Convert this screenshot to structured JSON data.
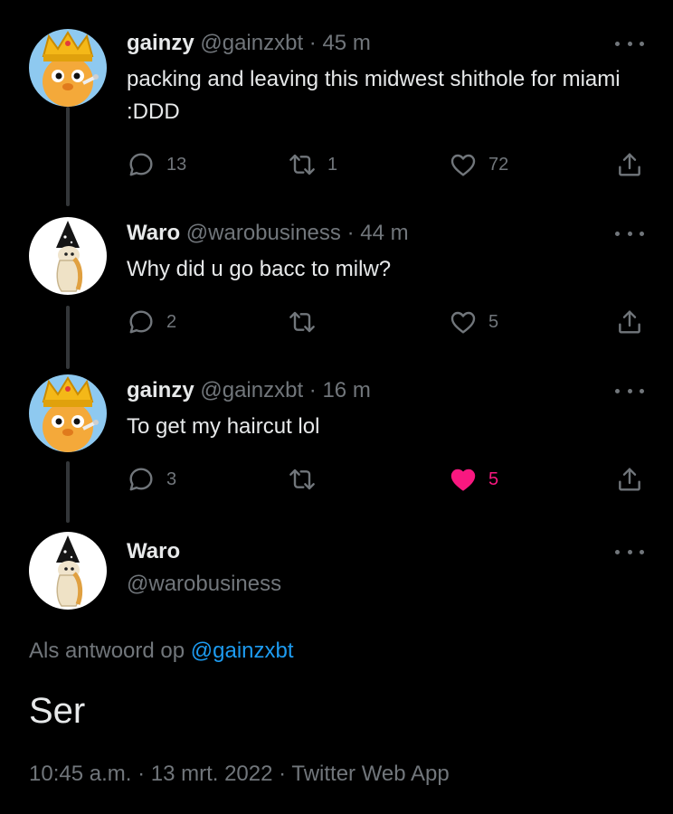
{
  "colors": {
    "background": "#000000",
    "text": "#e7e9ea",
    "muted": "#71767b",
    "accent": "#1d9bf0",
    "like": "#f91880"
  },
  "tweets": [
    {
      "name": "gainzy",
      "handle": "@gainzxbt",
      "time": "· 45 m",
      "text": "packing and leaving this midwest shithole for miami :DDD",
      "avatar": "gold-crown-bird-avatar",
      "replies": "13",
      "retweets": "1",
      "likes": "72",
      "liked": false
    },
    {
      "name": "Waro",
      "handle": "@warobusiness",
      "time": "· 44 m",
      "text": "Why did u go bacc to milw?",
      "avatar": "wizard-hat-character-avatar",
      "replies": "2",
      "retweets": "",
      "likes": "5",
      "liked": false
    },
    {
      "name": "gainzy",
      "handle": "@gainzxbt",
      "time": "· 16 m",
      "text": "To get my haircut lol",
      "avatar": "gold-crown-bird-avatar",
      "replies": "3",
      "retweets": "",
      "likes": "5",
      "liked": true
    }
  ],
  "main_tweet": {
    "name": "Waro",
    "handle": "@warobusiness",
    "avatar": "wizard-hat-character-avatar",
    "reply_prefix": "Als antwoord op",
    "reply_to": "@gainzxbt",
    "text": "Ser",
    "footer": "10:45 a.m. · 13 mrt. 2022 · Twitter Web App"
  },
  "icons": {
    "reply": "reply-icon",
    "retweet": "retweet-icon",
    "like": "heart-icon",
    "share": "share-icon",
    "more": "more-options-icon"
  }
}
